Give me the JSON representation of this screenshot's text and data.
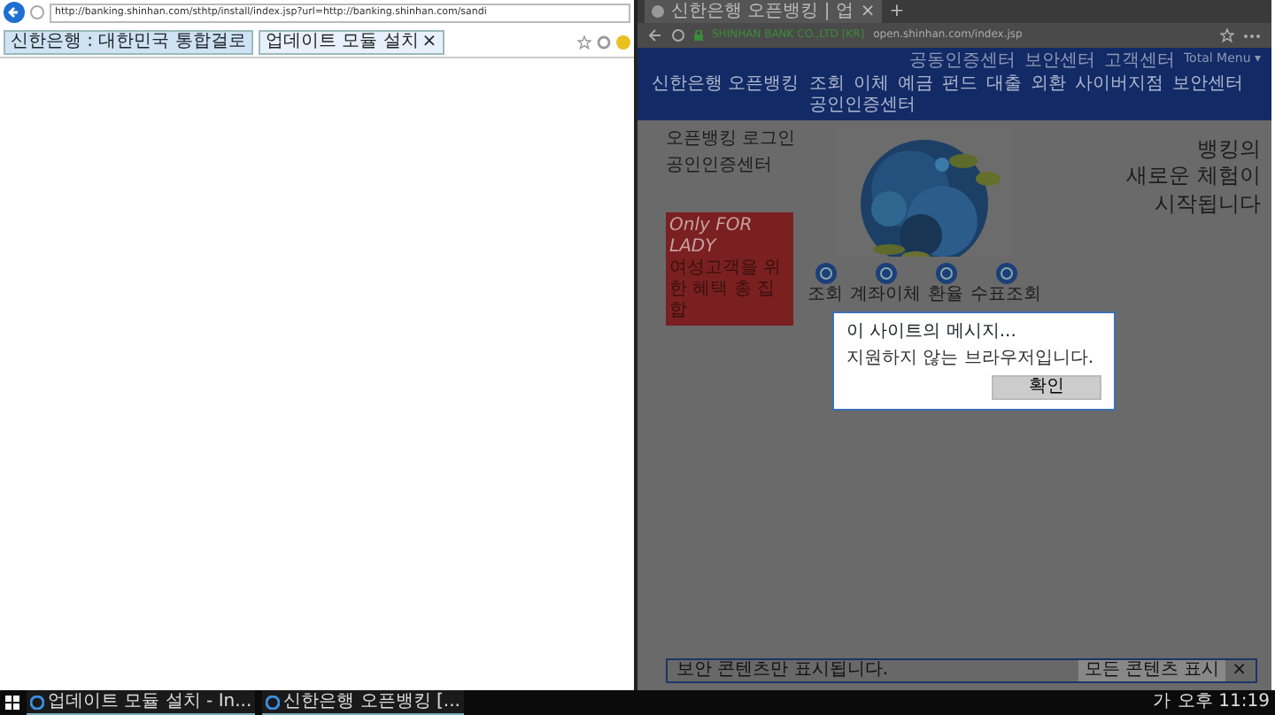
{
  "ie": {
    "address": "http://banking.shinhan.com/sthtp/install/index.jsp?url=http://banking.shinhan.com/sandi",
    "tabs": [
      {
        "label": "신한은행 : 대한민국 통합걸로",
        "selected": false
      },
      {
        "label": "업데이트 모듈 설치",
        "selected": true
      }
    ],
    "tab_close": "×"
  },
  "edge": {
    "tab": "신한은행 오픈뱅킹 | 업",
    "tab_close": "×",
    "new_tab": "+",
    "site_identity": "SHINHAN BANK CO.,LTD [KR]",
    "url": "open.shinhan.com/index.jsp"
  },
  "site": {
    "logo": "신한은행 오픈뱅킹",
    "utility_links": [
      "공동인증센터",
      "보안센터",
      "고객센터",
      "Total Menu ▾"
    ],
    "menu": [
      "조회",
      "이체",
      "예금",
      "펀드",
      "대출",
      "외환",
      "사이버지점",
      "보안센터",
      "공인인증센터"
    ],
    "login_links": [
      "오픈뱅킹 로그인",
      "공인인증센터"
    ],
    "headline": [
      "뱅킹의",
      "새로운 체험이",
      "시작됩니다"
    ],
    "quick_links": [
      "조회",
      "계좌이체",
      "환율",
      "수표조회"
    ],
    "promo": {
      "title": "Only FOR LADY",
      "subtitle": "여성고객을 위한 혜택 총 집합"
    }
  },
  "dialog": {
    "title": "이 사이트의 메시지...",
    "message": "지원하지 않는 브라우저입니다.",
    "button": "확인"
  },
  "info_bar": {
    "message": "보안 콘텐츠만 표시됩니다.",
    "button": "모든 콘텐츠 표시",
    "close": "×"
  },
  "taskbar": {
    "items": [
      "업데이트 모듈 설치 - In...",
      "신한은행 오픈뱅킹 [..."
    ],
    "ime": "가",
    "clock": "오후 11:19"
  }
}
